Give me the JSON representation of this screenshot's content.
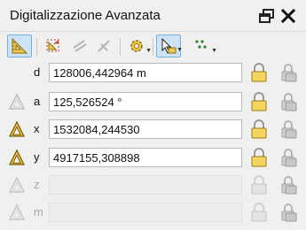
{
  "title": "Digitalizzazione Avanzata",
  "colors": {
    "cad_icon_fill": "#f2c94c",
    "lock_fill": "#f4d35e",
    "active_tool_bg": "#cde4f7",
    "disabled_text": "#a8a8a8"
  },
  "toolbar": {
    "tools": [
      {
        "name": "enable-advanced-digitizing-icon",
        "active": true
      },
      {
        "name": "construction-mode-icon",
        "active": false
      },
      {
        "name": "parallel-icon",
        "active": false
      },
      {
        "name": "perpendicular-icon",
        "active": false
      },
      {
        "name": "settings-gear-icon",
        "active": false,
        "dropdown": true
      },
      {
        "name": "snap-to-common-angles-icon",
        "active": true,
        "dropdown": true
      },
      {
        "name": "construction-guides-icon",
        "active": false,
        "dropdown": true
      }
    ]
  },
  "fields": {
    "d": {
      "label": "d",
      "value": "128006,442964 m",
      "enabled": true,
      "icon": false
    },
    "a": {
      "label": "a",
      "value": "125,526524 °",
      "enabled": true,
      "icon": "faded"
    },
    "x": {
      "label": "x",
      "value": "1532084,244530",
      "enabled": true,
      "icon": true
    },
    "y": {
      "label": "y",
      "value": "4917155,308898",
      "enabled": true,
      "icon": true
    },
    "z": {
      "label": "z",
      "value": "",
      "enabled": false,
      "icon": "faded"
    },
    "m": {
      "label": "m",
      "value": "",
      "enabled": false,
      "icon": "faded"
    }
  }
}
